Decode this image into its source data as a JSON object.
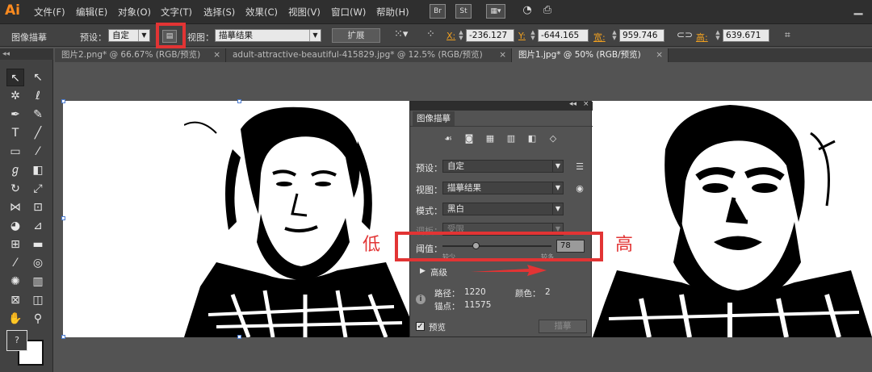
{
  "app": {
    "logo": "Ai"
  },
  "menu": [
    "文件(F)",
    "编辑(E)",
    "对象(O)",
    "文字(T)",
    "选择(S)",
    "效果(C)",
    "视图(V)",
    "窗口(W)",
    "帮助(H)"
  ],
  "menu_icons": {
    "bridge": "Br",
    "stock": "St"
  },
  "control_bar": {
    "title": "图像描摹",
    "preset_label": "预设：",
    "preset_value": "自定",
    "view_label": "视图：",
    "view_value": "描摹结果",
    "expand_button": "扩展",
    "x_label": "X:",
    "x_value": "-236.127",
    "y_label": "Y:",
    "y_value": "-644.165",
    "w_label": "宽:",
    "w_value": "959.746",
    "h_label": "高:",
    "h_value": "639.671"
  },
  "tabs": [
    {
      "label": "图片2.png* @ 66.67% (RGB/预览)"
    },
    {
      "label": "adult-attractive-beautiful-415829.jpg* @ 12.5% (RGB/预览)"
    },
    {
      "label": "图片1.jpg* @ 50% (RGB/预览)"
    }
  ],
  "annotations": {
    "low": "低",
    "high": "高"
  },
  "panel": {
    "tab_title": "图像描摹",
    "preset_label": "预设：",
    "preset_value": "自定",
    "view_label": "视图：",
    "view_value": "描摹结果",
    "mode_label": "模式：",
    "mode_value": "黑白",
    "palette_label": "调板：",
    "palette_value": "受限",
    "threshold_label": "阈值：",
    "threshold_value": "78",
    "threshold_fraction": 0.3,
    "threshold_min_caption": "较少",
    "threshold_max_caption": "较多",
    "advanced_label": "高级",
    "paths_label": "路径：",
    "paths_value": "1220",
    "colors_label": "颜色：",
    "colors_value": "2",
    "anchors_label": "锚点：",
    "anchors_value": "11575",
    "preview_label": "预览",
    "preview_checked": true,
    "trace_button": "描摹"
  },
  "colors": {
    "accent_red": "#e23434",
    "panel_bg": "#535353",
    "workspace_bg": "#535353",
    "ai_orange": "#ff8b1f"
  }
}
